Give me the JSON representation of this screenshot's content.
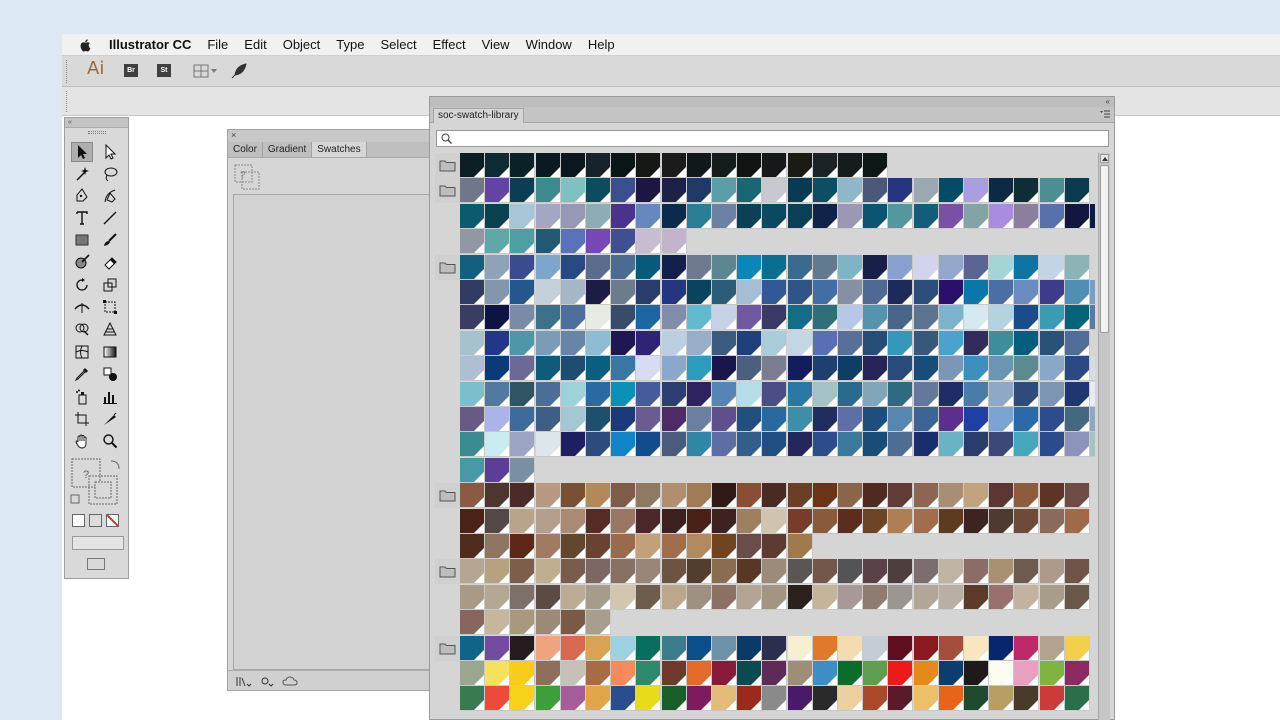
{
  "menubar": {
    "app_name": "Illustrator CC",
    "items": [
      "File",
      "Edit",
      "Object",
      "Type",
      "Select",
      "Effect",
      "View",
      "Window",
      "Help"
    ]
  },
  "controlbar": {
    "logo": "Ai",
    "bridge_label": "Br",
    "stock_label": "St"
  },
  "toolbox": {
    "collapse_label": "«"
  },
  "swatches_panel": {
    "collapse_label": "×",
    "tabs": [
      {
        "label": "Color",
        "active": false
      },
      {
        "label": "Gradient",
        "active": false
      },
      {
        "label": "Swatches",
        "active": true
      }
    ],
    "bottom_icons": [
      "libraries-menu-icon",
      "show-kinds-icon",
      "cloud-icon"
    ]
  },
  "library": {
    "tab_label": "soc-swatch-library",
    "collapse_label": "«",
    "search_placeholder": "",
    "groups": [
      {
        "rows": [
          [
            "#0c1d24",
            "#0e2a33",
            "#0b2128",
            "#0a1a20",
            "#0b171c",
            "#18222a",
            "#0b1617",
            "#161816",
            "#1a1b1a",
            "#11181c",
            "#141d1c",
            "#101514",
            "#15191a",
            "#1b1b16",
            "#1c2326",
            "#141c1d",
            "#0c1816"
          ]
        ]
      },
      {
        "rows": [
          [
            "#6f7788",
            "#6344a3",
            "#0b3d53",
            "#3d8a8e",
            "#7fc0c0",
            "#0b4c5e",
            "#3b4f90",
            "#1d1641",
            "#1d2147",
            "#1f3a66",
            "#5a9fa8",
            "#1b6673",
            "#c6c8cf",
            "#083a53",
            "#0b4e62",
            "#8fb6c9",
            "#4c5879",
            "#26357f",
            "#9aa8b1",
            "#034c67",
            "#a89ee0",
            "#0c2a43",
            "#0f2d36",
            "#4c8f93",
            "#0c3b4f"
          ],
          [
            "#0b5a6e",
            "#0a414f",
            "#a6c5d6",
            "#a3a7c3",
            "#9798b5",
            "#8dacb4",
            "#4a328d",
            "#6788be",
            "#0b2b4d",
            "#2a7f97",
            "#6b82a4",
            "#0b4057",
            "#0a4962",
            "#074057",
            "#112349",
            "#9b97b5",
            "#0a5571",
            "#52989d",
            "#135d78",
            "#7950a6",
            "#85a2a5",
            "#a98cdf",
            "#8c7f9d",
            "#5870ab",
            "#13173f",
            "#0b1b42"
          ],
          [
            "#9099a3",
            "#60a8a7",
            "#4e9ea5",
            "#215973",
            "#5a72b9",
            "#7648b6",
            "#3f4f92",
            "#c7bcd2",
            "#c3b3cc"
          ]
        ]
      },
      {
        "rows": [
          [
            "#13607e",
            "#8fa3b8",
            "#3a4b8f",
            "#7ea5cc",
            "#274a83",
            "#5c6c8e",
            "#4b6b92",
            "#075a79",
            "#141f4b",
            "#6f7a90",
            "#5c8690",
            "#0b86b8",
            "#086f91",
            "#3a6a8e",
            "#627a8f",
            "#7fb4c7",
            "#191f4b",
            "#88a1d0",
            "#d1d4ec",
            "#93a7cc",
            "#5a6594",
            "#a4d5d6",
            "#0e74a2",
            "#c2d4e6",
            "#8cb3b6"
          ],
          [
            "#303a63",
            "#8296ae",
            "#24578b",
            "#c4cfd9",
            "#a5b6c6",
            "#1c1d47",
            "#6e7b8d",
            "#2a3c6a",
            "#23367f",
            "#0a435f",
            "#2a5d7a",
            "#a6bed5",
            "#325895",
            "#2e5488",
            "#426ea5",
            "#8590a3",
            "#4e6a94",
            "#1e2a5c",
            "#2d4d7c",
            "#2a0f6b",
            "#0b76a8",
            "#496fa5",
            "#6a8bbe",
            "#3c3c8a",
            "#4f8fb6",
            "#7c9cc0"
          ],
          [
            "#3a3c63",
            "#0e1341",
            "#7b8aa5",
            "#3d718a",
            "#4e6e9c",
            "#e6ece4",
            "#394b6a",
            "#1d66a1",
            "#828ea9",
            "#63b9cd",
            "#c7d2e6",
            "#7059a0",
            "#3b3a66",
            "#146c87",
            "#2f6f79",
            "#b7c8e6",
            "#5494ae",
            "#486687",
            "#5d7490",
            "#7bb4cc",
            "#d5e9ef",
            "#b3d3e0",
            "#1b4c8a",
            "#3b9bb4",
            "#066378",
            "#5d7aa0"
          ],
          [
            "#a6c3cd",
            "#23378a",
            "#4f97a8",
            "#7b9cb4",
            "#6785a7",
            "#8dbdd4",
            "#1e1754",
            "#2e2474",
            "#bccee2",
            "#98adc8",
            "#3b5c80",
            "#20407c",
            "#a9cdd8",
            "#c4d6e4",
            "#586fb5",
            "#5a6f98",
            "#264d76",
            "#3398b9",
            "#37587b",
            "#4aa3cf",
            "#302c5b",
            "#3e8d9a",
            "#035d7c",
            "#2a5277",
            "#4f6d96"
          ],
          [
            "#aebfd4",
            "#0a3a7a",
            "#6c6a94",
            "#0f5c7a",
            "#1f4d70",
            "#0a5e7e",
            "#3a76a4",
            "#d7dcf1",
            "#8aa8cc",
            "#2c9dbd",
            "#18164a",
            "#4c5f7e",
            "#7b7e93",
            "#141d5c",
            "#1f3f6e",
            "#0e3d66",
            "#262458",
            "#2a4a7c",
            "#174d78",
            "#7b96b6",
            "#3d8fbd",
            "#6a96b2",
            "#5d8990",
            "#8aa7c8",
            "#2b4a84",
            "#d4dce5"
          ],
          [
            "#7cbfcc",
            "#5279a0",
            "#2f5564",
            "#4b6d97",
            "#9dd2d8",
            "#2b6aa0",
            "#0b90b8",
            "#445c9c",
            "#2c3f72",
            "#30215f",
            "#5585b4",
            "#b4dde8",
            "#4b4d86",
            "#2c78a4",
            "#a5c1c8",
            "#2a6a8f",
            "#7fa6b9",
            "#2e6b82",
            "#65789b",
            "#202c66",
            "#4a7caa",
            "#8ea9c6",
            "#2d4c7a",
            "#7c95b2",
            "#1f3770",
            "#e5ecf8"
          ],
          [
            "#675a84",
            "#aab4e9",
            "#3d6c9a",
            "#3e5d87",
            "#a3c8d1",
            "#1f4f6e",
            "#1b3a7a",
            "#6a5c8e",
            "#4e2a66",
            "#6b7fa0",
            "#5f4f8c",
            "#224f80",
            "#2a68a0",
            "#3d8ea8",
            "#1f2e5f",
            "#5e6ea6",
            "#1e4e7c",
            "#5587b0",
            "#3c6494",
            "#5c2e8e",
            "#1e3fa4",
            "#7ba4d0",
            "#2b6aa8",
            "#2d4c8c",
            "#446880",
            "#8fa8c0"
          ],
          [
            "#3a8b90",
            "#c8ecef",
            "#9ba4c3",
            "#dce6eb",
            "#1f1e62",
            "#2b4c7d",
            "#0f85c8",
            "#134b8c",
            "#4a5c7e",
            "#2f86a6",
            "#5b6da2",
            "#325e8c",
            "#1e4e82",
            "#24265c",
            "#2d4c8c",
            "#3c7a9c",
            "#1a4c7a",
            "#4e6c94",
            "#1a2e6e",
            "#68b4c4",
            "#2a3c6c",
            "#3e4878",
            "#46a6bc",
            "#2a4c8c",
            "#8c94bc",
            "#a4c4c4"
          ],
          [
            "#4799a7",
            "#5c3d97",
            "#7a8ea4"
          ]
        ]
      },
      {
        "rows": [
          [
            "#8a5a44",
            "#4d3630",
            "#4c2a26",
            "#b99882",
            "#7a5035",
            "#b3895a",
            "#7f5c49",
            "#8e7a62",
            "#b08e6e",
            "#a07b54",
            "#301a17",
            "#8a4e36",
            "#4a2b24",
            "#6b3e26",
            "#6b3317",
            "#8a6549",
            "#4e2a20",
            "#613b35",
            "#8e6452",
            "#a88e75",
            "#c2a380",
            "#5b3633",
            "#8c5c3d",
            "#5e3427",
            "#6e4c45"
          ],
          [
            "#4a2316",
            "#544847",
            "#b9a389",
            "#b49e8e",
            "#aa8a72",
            "#562b25",
            "#9a7664",
            "#4b2729",
            "#3c1f1f",
            "#4a2117",
            "#3e2220",
            "#a07e60",
            "#d0c4b0",
            "#783c28",
            "#8a5a3c",
            "#5c2d1e",
            "#6e4426",
            "#b07e54",
            "#a06e4c",
            "#5e3a20",
            "#3c2420",
            "#4e3a30",
            "#6e4a3a",
            "#8a6a5a",
            "#a06a4a"
          ],
          [
            "#502c1e",
            "#8e7662",
            "#5e2818",
            "#a07a62",
            "#62472e",
            "#6a4232",
            "#9a6a4c",
            "#c2a07a",
            "#a06e4c",
            "#b28a62",
            "#704420",
            "#6a4c4a",
            "#5e3a30",
            "#a07a4c"
          ]
        ]
      },
      {
        "rows": [
          [
            "#b4a690",
            "#b7a27f",
            "#7d5e4a",
            "#bfae8f",
            "#7a5c4c",
            "#7c6763",
            "#877064",
            "#9a8678",
            "#6d5342",
            "#533d2f",
            "#8a6c4e",
            "#593823",
            "#9c8b7b",
            "#5a5654",
            "#73574b",
            "#545356",
            "#5a4248",
            "#4e3e3e",
            "#7c6e6e",
            "#c0b4a4",
            "#8c6c64",
            "#a89070",
            "#6e5a4e",
            "#ad9a8a",
            "#70544a"
          ],
          [
            "#a89a86",
            "#b4a894",
            "#7c7068",
            "#5c4a44",
            "#bcab95",
            "#a69c8c",
            "#d2c6ae",
            "#6e5c4c",
            "#bca68c",
            "#a09082",
            "#8c7064",
            "#b4a494",
            "#a49482",
            "#2a201c",
            "#c6b49a",
            "#a89898",
            "#8e7c70",
            "#9c9692",
            "#b2a698",
            "#b8b0a4",
            "#5e3a28",
            "#98706c",
            "#c2b29e",
            "#a89c8a",
            "#6c5848"
          ],
          [
            "#886660",
            "#c6b69e",
            "#a89880",
            "#9c8a78",
            "#7a5a44",
            "#a89e8e"
          ]
        ]
      },
      {
        "rows": [
          [
            "#0f6587",
            "#734ba0",
            "#271a1e",
            "#efa37f",
            "#d66a4f",
            "#d9a354",
            "#9bd1e0",
            "#0a6e5e",
            "#3c7d8c",
            "#0a4e8c",
            "#6d93a8",
            "#0a3a66",
            "#2c2e50",
            "#f7efd2",
            "#e07a2a",
            "#f2dcb0",
            "#c4ccd6",
            "#5e0e1e",
            "#8a1a20",
            "#a44e3c",
            "#f8e6c0",
            "#08266e",
            "#be2a68",
            "#b4a290",
            "#f2d04c"
          ],
          [
            "#9ba690",
            "#f5e15e",
            "#f7cc1a",
            "#8e6e5c",
            "#c6c0b8",
            "#a86c44",
            "#f58a5c",
            "#2e8a6c",
            "#6e3a2c",
            "#e46a2a",
            "#8a1a3a",
            "#0a4a50",
            "#5e2a58",
            "#9e8e78",
            "#3c8ec4",
            "#0a6e2a",
            "#5e9e4e",
            "#ec1a1a",
            "#e48a1a",
            "#0a3e6e",
            "#1e1a1a",
            "#fcfcf0",
            "#e8a0c0",
            "#7fb43e",
            "#8e2a62"
          ],
          [
            "#3a7a50",
            "#ec4a3a",
            "#f6d21a",
            "#3e9e3a",
            "#a65e9a",
            "#e2a64a",
            "#2a4e8c",
            "#e8dc1a",
            "#1a5e2a",
            "#7e1a5e",
            "#e4bc7a",
            "#9a2a1a",
            "#8a8a8a",
            "#4a1a6a",
            "#2a2a2a",
            "#ecd0a0",
            "#aa4a2a",
            "#5a1a2a",
            "#ecc06a",
            "#e8641a",
            "#1e4a2e",
            "#b89e64",
            "#4a3a2a",
            "#cc3a3a",
            "#2a6e4a"
          ]
        ]
      }
    ]
  }
}
